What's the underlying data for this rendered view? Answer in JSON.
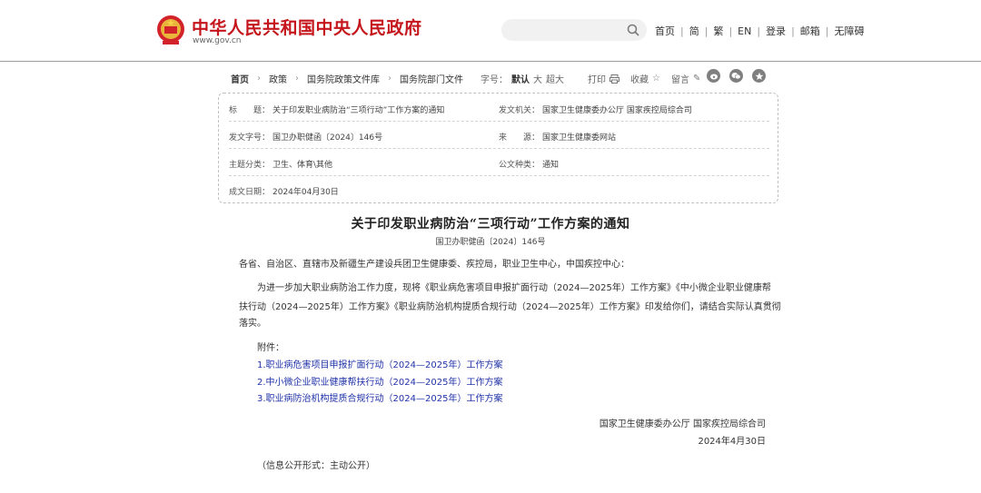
{
  "header": {
    "site_title": "中华人民共和国中央人民政府",
    "site_url": "www.gov.cn",
    "search_placeholder": "",
    "nav": [
      "首页",
      "简",
      "繁",
      "EN",
      "登录",
      "邮箱",
      "无障碍"
    ]
  },
  "breadcrumb": {
    "items": [
      "首页",
      "政策",
      "国务院政策文件库",
      "国务院部门文件"
    ]
  },
  "tools": {
    "font_label": "字号：",
    "font_default": "默认",
    "font_large": "大",
    "font_xlarge": "超大",
    "print": "打印",
    "favorite": "收藏",
    "comment": "留言"
  },
  "info": {
    "title_label": "标　　题：",
    "title_value": "关于印发职业病防治“三项行动”工作方案的通知",
    "issuer_label": "发文机关：",
    "issuer_value": "国家卫生健康委办公厅  国家疾控局综合司",
    "docno_label": "发文字号：",
    "docno_value": "国卫办职健函〔2024〕146号",
    "source_label": "来　　源：",
    "source_value": "国家卫生健康委网站",
    "topic_label": "主题分类：",
    "topic_value": "卫生、体育\\其他",
    "type_label": "公文种类：",
    "type_value": "通知",
    "date_label": "成文日期：",
    "date_value": "2024年04月30日"
  },
  "doc": {
    "title": "关于印发职业病防治“三项行动”工作方案的通知",
    "number": "国卫办职健函〔2024〕146号",
    "salutation": "各省、自治区、直辖市及新疆生产建设兵团卫生健康委、疾控局，职业卫生中心，中国疾控中心：",
    "body_line1": "为进一步加大职业病防治工作力度，现将《职业病危害项目申报扩面行动（2024—2025年）工作方案》《中小微企业职业健康帮",
    "body_line2": "扶行动（2024—2025年）工作方案》《职业病防治机构提质合规行动（2024—2025年）工作方案》印发给你们，请结合实际认真贯彻",
    "body_line3": "落实。",
    "attach_label": "附件：",
    "attachments": [
      "1.职业病危害项目申报扩面行动（2024—2025年）工作方案",
      "2.中小微企业职业健康帮扶行动（2024—2025年）工作方案",
      "3.职业病防治机构提质合规行动（2024—2025年）工作方案"
    ],
    "signer": "国家卫生健康委办公厅  国家疾控局综合司",
    "sign_date": "2024年4月30日",
    "disclosure": "（信息公开形式：主动公开）"
  },
  "colors": {
    "brand_red": "#c4161c",
    "link_blue": "#2133a8"
  }
}
